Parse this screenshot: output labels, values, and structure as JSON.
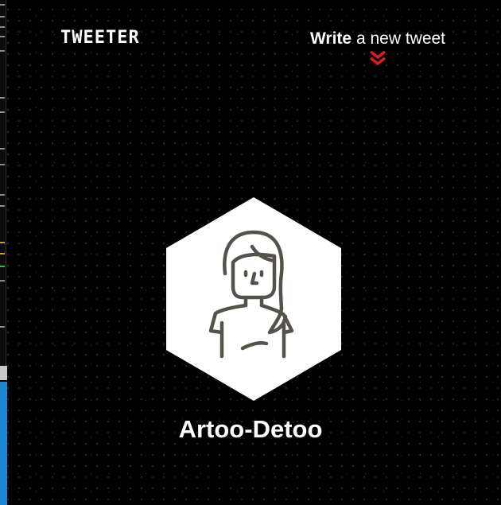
{
  "header": {
    "brand": "TWEETER",
    "compose_strong": "Write",
    "compose_rest": " a new tweet",
    "chevron_icon": "double-chevron-down-icon",
    "chevron_color": "#e01b24"
  },
  "profile": {
    "avatar_icon": "woman-avatar-icon",
    "name": "Artoo-Detoo"
  },
  "colors": {
    "background": "#000000",
    "hexagon": "#ffffff",
    "avatar_stroke": "#55524b"
  }
}
